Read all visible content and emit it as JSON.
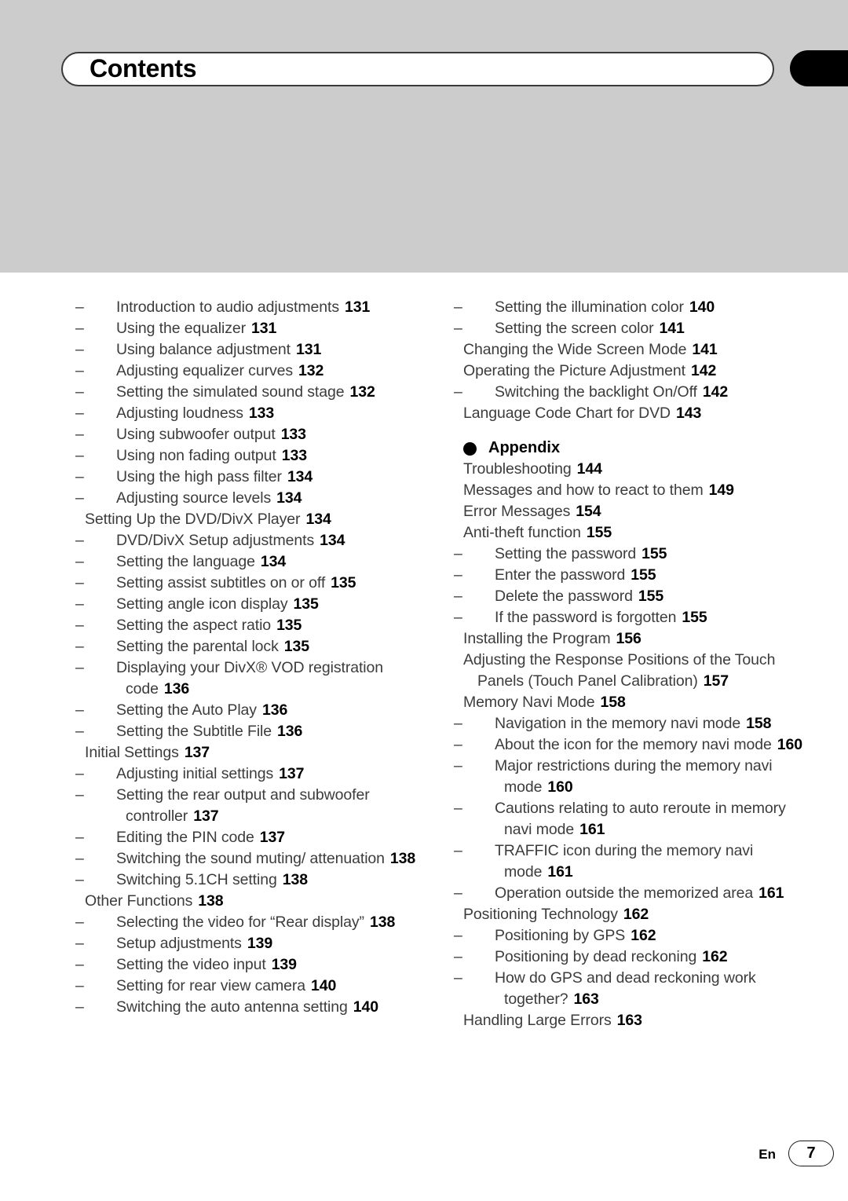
{
  "header": {
    "title": "Contents"
  },
  "toc": {
    "left_column": [
      {
        "level": 2,
        "text": "Introduction to audio adjustments",
        "page": "131"
      },
      {
        "level": 2,
        "text": "Using the equalizer",
        "page": "131"
      },
      {
        "level": 2,
        "text": "Using balance adjustment",
        "page": "131"
      },
      {
        "level": 2,
        "text": "Adjusting equalizer curves",
        "page": "132"
      },
      {
        "level": 2,
        "text": "Setting the simulated sound stage",
        "page": "132"
      },
      {
        "level": 2,
        "text": "Adjusting loudness",
        "page": "133"
      },
      {
        "level": 2,
        "text": "Using subwoofer output",
        "page": "133"
      },
      {
        "level": 2,
        "text": "Using non fading output",
        "page": "133"
      },
      {
        "level": 2,
        "text": "Using the high pass filter",
        "page": "134"
      },
      {
        "level": 2,
        "text": "Adjusting source levels",
        "page": "134"
      },
      {
        "level": 1,
        "text": "Setting Up the DVD/DivX Player",
        "page": "134"
      },
      {
        "level": 2,
        "text": "DVD/DivX Setup adjustments",
        "page": "134"
      },
      {
        "level": 2,
        "text": "Setting the language",
        "page": "134"
      },
      {
        "level": 2,
        "text": "Setting assist subtitles on or off",
        "page": "135"
      },
      {
        "level": 2,
        "text": "Setting angle icon display",
        "page": "135"
      },
      {
        "level": 2,
        "text": "Setting the aspect ratio",
        "page": "135"
      },
      {
        "level": 2,
        "text": "Setting the parental lock",
        "page": "135"
      },
      {
        "level": 2,
        "text": "Displaying your DivX® VOD registration code",
        "page": "136"
      },
      {
        "level": 2,
        "text": "Setting the Auto Play",
        "page": "136"
      },
      {
        "level": 2,
        "text": "Setting the Subtitle File",
        "page": "136"
      },
      {
        "level": 1,
        "text": "Initial Settings",
        "page": "137"
      },
      {
        "level": 2,
        "text": "Adjusting initial settings",
        "page": "137"
      },
      {
        "level": 2,
        "text": "Setting the rear output and subwoofer controller",
        "page": "137"
      },
      {
        "level": 2,
        "text": "Editing the PIN code",
        "page": "137"
      },
      {
        "level": 2,
        "text": "Switching the sound muting/ attenuation",
        "page": "138"
      },
      {
        "level": 2,
        "text": "Switching 5.1CH setting",
        "page": "138"
      },
      {
        "level": 1,
        "text": "Other Functions",
        "page": "138"
      },
      {
        "level": 2,
        "text": "Selecting the video for “Rear display”",
        "page": "138"
      },
      {
        "level": 2,
        "text": "Setup adjustments",
        "page": "139"
      },
      {
        "level": 2,
        "text": "Setting the video input",
        "page": "139"
      },
      {
        "level": 2,
        "text": "Setting for rear view camera",
        "page": "140"
      },
      {
        "level": 2,
        "text": "Switching the auto antenna setting",
        "page": "140"
      }
    ],
    "right_column_top": [
      {
        "level": 2,
        "text": "Setting the illumination color",
        "page": "140"
      },
      {
        "level": 2,
        "text": "Setting the screen color",
        "page": "141"
      },
      {
        "level": 1,
        "text": "Changing the Wide Screen Mode",
        "page": "141"
      },
      {
        "level": 1,
        "text": "Operating the Picture Adjustment",
        "page": "142"
      },
      {
        "level": 2,
        "text": "Switching the backlight On/Off",
        "page": "142"
      },
      {
        "level": 1,
        "text": "Language Code Chart for DVD",
        "page": "143"
      }
    ],
    "appendix_heading": "Appendix",
    "right_column_appendix": [
      {
        "level": 1,
        "text": "Troubleshooting",
        "page": "144"
      },
      {
        "level": 1,
        "text": "Messages and how to react to them",
        "page": "149"
      },
      {
        "level": 1,
        "text": "Error Messages",
        "page": "154"
      },
      {
        "level": 1,
        "text": "Anti-theft function",
        "page": "155"
      },
      {
        "level": 2,
        "text": "Setting the password",
        "page": "155"
      },
      {
        "level": 2,
        "text": "Enter the password",
        "page": "155"
      },
      {
        "level": 2,
        "text": "Delete the password",
        "page": "155"
      },
      {
        "level": 2,
        "text": "If the password is forgotten",
        "page": "155"
      },
      {
        "level": 1,
        "text": "Installing the Program",
        "page": "156"
      },
      {
        "level": 1,
        "text": "Adjusting the Response Positions of the Touch Panels (Touch Panel Calibration)",
        "page": "157"
      },
      {
        "level": 1,
        "text": "Memory Navi Mode",
        "page": "158"
      },
      {
        "level": 2,
        "text": "Navigation in the memory navi mode",
        "page": "158"
      },
      {
        "level": 2,
        "text": "About the icon for the memory navi mode",
        "page": "160"
      },
      {
        "level": 2,
        "text": "Major restrictions during the memory navi mode",
        "page": "160"
      },
      {
        "level": 2,
        "text": "Cautions relating to auto reroute in memory navi mode",
        "page": "161"
      },
      {
        "level": 2,
        "text": "TRAFFIC icon during the memory navi mode",
        "page": "161"
      },
      {
        "level": 2,
        "text": "Operation outside the memorized area",
        "page": "161"
      },
      {
        "level": 1,
        "text": "Positioning Technology",
        "page": "162"
      },
      {
        "level": 2,
        "text": "Positioning by GPS",
        "page": "162"
      },
      {
        "level": 2,
        "text": "Positioning by dead reckoning",
        "page": "162"
      },
      {
        "level": 2,
        "text": "How do GPS and dead reckoning work together?",
        "page": "163"
      },
      {
        "level": 1,
        "text": "Handling Large Errors",
        "page": "163"
      }
    ]
  },
  "footer": {
    "language": "En",
    "page_number": "7"
  },
  "colors": {
    "band_gray": "#cccccc",
    "text_gray": "#3c3c3c",
    "accent_black": "#000000"
  }
}
